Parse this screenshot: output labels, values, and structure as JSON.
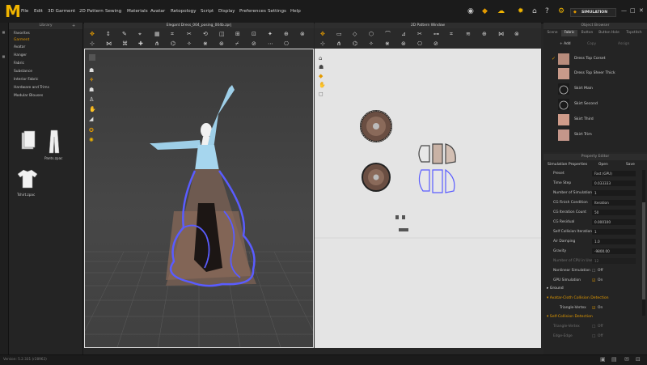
{
  "menubar": {
    "items": [
      "File",
      "Edit",
      "3D Garment",
      "2D Pattern",
      "Sewing",
      "Materials",
      "Avatar",
      "Retopology",
      "Script",
      "Display",
      "Preferences",
      "Settings",
      "Help"
    ],
    "mode_label": "SIMULATION"
  },
  "library": {
    "title": "Library",
    "items": [
      "Favorites",
      "Garment",
      "Avatar",
      "Hanger",
      "Fabric",
      "Substance",
      "Interior Fabric",
      "Hardware and Trims",
      "Modular Blouses"
    ],
    "active_index": 1,
    "thumbs": [
      "Pants.zpac",
      "Tshirt.zpac"
    ]
  },
  "win3d": {
    "title": "Elegant Dress_004_posing_004b.zprj"
  },
  "win2d": {
    "title": "2D Pattern Window"
  },
  "object_browser": {
    "title": "Object Browser",
    "tabs": [
      "Scene",
      "Fabric",
      "Button",
      "Button Hole",
      "Topstitch"
    ],
    "active_tab": 1,
    "actions": [
      "+ Add",
      "Copy",
      "Assign"
    ],
    "fabrics": [
      "Dress Top Corset",
      "Dress Top Sheer Thick",
      "Skirt Main",
      "Skirt Second",
      "Skirt Third",
      "Skirt Trim"
    ]
  },
  "property_editor": {
    "title": "Property Editor",
    "header": "Simulation Properties",
    "open_label": "Open",
    "save_label": "Save",
    "rows": [
      {
        "name": "Preset",
        "value": "Fast (GPU)"
      },
      {
        "name": "Time Step",
        "value": "0.033333"
      },
      {
        "name": "Number of Simulation",
        "value": "1"
      },
      {
        "name": "CG Finish Condition",
        "value": "Iteration"
      },
      {
        "name": "CG Iteration Count",
        "value": "50"
      },
      {
        "name": "CG Residual",
        "value": "0.000100"
      },
      {
        "name": "Self Collision Iteration Co.",
        "value": "1"
      },
      {
        "name": "Air Damping",
        "value": "1.0"
      },
      {
        "name": "Gravity",
        "value": "-9800.00"
      },
      {
        "name": "Number of CPU in Use",
        "value": "12"
      },
      {
        "name": "Nonlinear Simulation",
        "value": "Off"
      },
      {
        "name": "GPU Simulation",
        "value": "On"
      }
    ],
    "sections": [
      "Ground",
      "Avatar-Cloth Collision Detection",
      "Self-Collision Detection"
    ],
    "collision_value": "Triangle-Vertex",
    "collision_state": "On",
    "self_rows": [
      {
        "name": "Triangle-Vertex",
        "value": "Off"
      },
      {
        "name": "Edge-Edge",
        "value": "Off"
      }
    ]
  },
  "status": {
    "version": "Version: 5.2.331 (r28962)"
  },
  "colors": {
    "accent": "#e39a00",
    "selection": "#5a5cff"
  }
}
